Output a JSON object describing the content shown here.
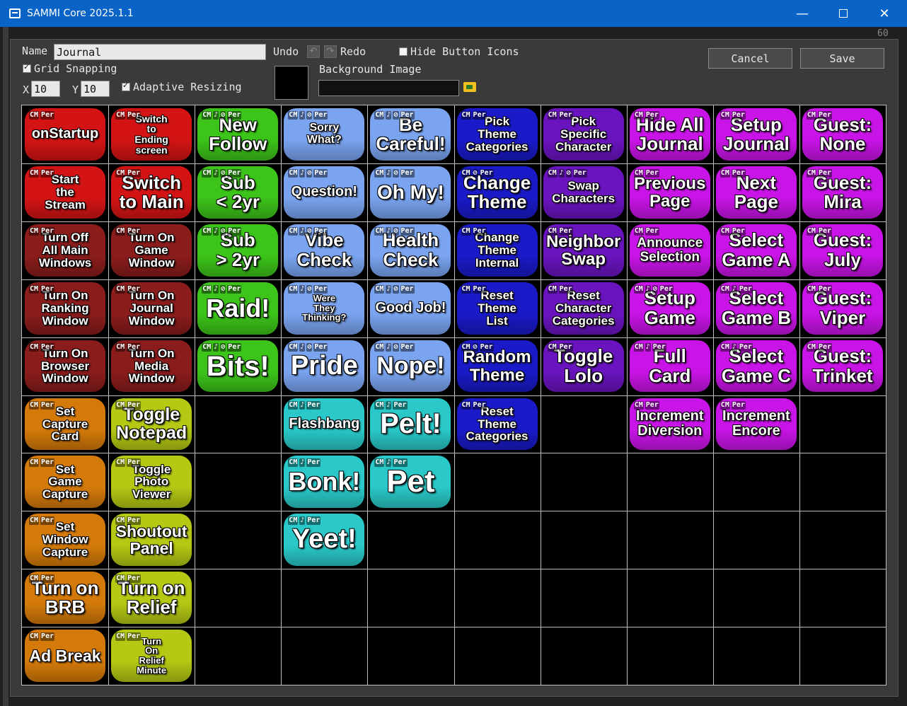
{
  "window": {
    "title": "SAMMI Core 2025.1.1",
    "min_glyph": "—",
    "close_glyph": "✕"
  },
  "background": {
    "corner_number": "60"
  },
  "form": {
    "name_label": "Name",
    "name_value": "Journal",
    "undo_label": "Undo",
    "undo_glyph": "↶",
    "redo_glyph": "↷",
    "redo_label": "Redo",
    "hide_icons_label": "Hide Button Icons",
    "hide_icons_checked": false,
    "grid_snapping_label": "Grid Snapping",
    "grid_snapping_checked": true,
    "x_label": "X",
    "x_value": "10",
    "y_label": "Y",
    "y_value": "10",
    "adaptive_label": "Adaptive Resizing",
    "adaptive_checked": true,
    "bg_image_label": "Background Image",
    "bg_image_value": "",
    "bg_color": "#000000",
    "cancel_label": "Cancel",
    "save_label": "Save"
  },
  "grid": {
    "columns": 10,
    "rows": 10,
    "buttons": [
      {
        "c": 0,
        "r": 0,
        "text": "onStartup",
        "color": "#d41414",
        "size": 20,
        "icons": [
          "CM",
          "Per"
        ]
      },
      {
        "c": 1,
        "r": 0,
        "text": "Switch\nto\nEnding\nscreen",
        "color": "#d41414",
        "size": 14,
        "icons": [
          "CM",
          "Per"
        ]
      },
      {
        "c": 2,
        "r": 0,
        "text": "New\nFollow",
        "color": "#3cc41a",
        "size": 26,
        "icons": [
          "CM",
          "♪",
          "⊘",
          "Per"
        ]
      },
      {
        "c": 3,
        "r": 0,
        "text": "Sorry\nWhat?",
        "color": "#7aa4f0",
        "size": 16,
        "icons": [
          "CM",
          "♪",
          "⊘",
          "Per"
        ]
      },
      {
        "c": 4,
        "r": 0,
        "text": "Be\nCareful!",
        "color": "#7aa4f0",
        "size": 26,
        "icons": [
          "CM",
          "♪",
          "⊘",
          "Per"
        ]
      },
      {
        "c": 5,
        "r": 0,
        "text": "Pick\nTheme\nCategories",
        "color": "#1a1ac8",
        "size": 17,
        "icons": [
          "CM",
          "Per"
        ]
      },
      {
        "c": 6,
        "r": 0,
        "text": "Pick\nSpecific\nCharacter",
        "color": "#6a14c0",
        "size": 17,
        "icons": [
          "CM",
          "Per"
        ]
      },
      {
        "c": 7,
        "r": 0,
        "text": "Hide All\nJournal",
        "color": "#c814e6",
        "size": 26,
        "icons": [
          "CM",
          "Per"
        ]
      },
      {
        "c": 8,
        "r": 0,
        "text": "Setup\nJournal",
        "color": "#c814e6",
        "size": 26,
        "icons": [
          "CM",
          "Per"
        ]
      },
      {
        "c": 9,
        "r": 0,
        "text": "Guest:\nNone",
        "color": "#c814e6",
        "size": 26,
        "icons": [
          "CM",
          "Per"
        ]
      },
      {
        "c": 0,
        "r": 1,
        "text": "Start\nthe\nStream",
        "color": "#d41414",
        "size": 17,
        "icons": [
          "CM",
          "Per"
        ]
      },
      {
        "c": 1,
        "r": 1,
        "text": "Switch\nto Main",
        "color": "#d41414",
        "size": 26,
        "icons": [
          "CM",
          "Per"
        ]
      },
      {
        "c": 2,
        "r": 1,
        "text": "Sub\n< 2yr",
        "color": "#3cc41a",
        "size": 26,
        "icons": [
          "CM",
          "♪",
          "⊘",
          "Per"
        ]
      },
      {
        "c": 3,
        "r": 1,
        "text": "Question!",
        "color": "#7aa4f0",
        "size": 20,
        "icons": [
          "CM",
          "♪",
          "⊘",
          "Per"
        ]
      },
      {
        "c": 4,
        "r": 1,
        "text": "Oh My!",
        "color": "#7aa4f0",
        "size": 28,
        "icons": [
          "CM",
          "♪",
          "⊘",
          "Per"
        ]
      },
      {
        "c": 5,
        "r": 1,
        "text": "Change\nTheme",
        "color": "#1a1ac8",
        "size": 26,
        "icons": [
          "CM",
          "⊘",
          "Per"
        ]
      },
      {
        "c": 6,
        "r": 1,
        "text": "Swap\nCharacters",
        "color": "#6a14c0",
        "size": 17,
        "icons": [
          "CM",
          "♪",
          "⊘",
          "Per"
        ]
      },
      {
        "c": 7,
        "r": 1,
        "text": "Previous\nPage",
        "color": "#c814e6",
        "size": 24,
        "icons": [
          "CM",
          "Per"
        ]
      },
      {
        "c": 8,
        "r": 1,
        "text": "Next\nPage",
        "color": "#c814e6",
        "size": 26,
        "icons": [
          "CM",
          "Per"
        ]
      },
      {
        "c": 9,
        "r": 1,
        "text": "Guest:\nMira",
        "color": "#c814e6",
        "size": 26,
        "icons": [
          "CM",
          "Per"
        ]
      },
      {
        "c": 0,
        "r": 2,
        "text": "Turn Off\nAll Main\nWindows",
        "color": "#8a1c1c",
        "size": 17,
        "icons": [
          "CM",
          "Per"
        ]
      },
      {
        "c": 1,
        "r": 2,
        "text": "Turn On\nGame\nWindow",
        "color": "#8a1c1c",
        "size": 17,
        "icons": [
          "CM",
          "Per"
        ]
      },
      {
        "c": 2,
        "r": 2,
        "text": "Sub\n> 2yr",
        "color": "#3cc41a",
        "size": 26,
        "icons": [
          "CM",
          "♪",
          "⊘",
          "Per"
        ]
      },
      {
        "c": 3,
        "r": 2,
        "text": "Vibe\nCheck",
        "color": "#7aa4f0",
        "size": 26,
        "icons": [
          "CM",
          "♪",
          "⊘",
          "Per"
        ]
      },
      {
        "c": 4,
        "r": 2,
        "text": "Health\nCheck",
        "color": "#7aa4f0",
        "size": 26,
        "icons": [
          "CM",
          "♪",
          "⊘",
          "Per"
        ]
      },
      {
        "c": 5,
        "r": 2,
        "text": "Change\nTheme\nInternal",
        "color": "#1a1ac8",
        "size": 17,
        "icons": [
          "CM",
          "Per"
        ]
      },
      {
        "c": 6,
        "r": 2,
        "text": "Neighbor\nSwap",
        "color": "#6a14c0",
        "size": 24,
        "icons": [
          "CM",
          "Per"
        ]
      },
      {
        "c": 7,
        "r": 2,
        "text": "Announce\nSelection",
        "color": "#c814e6",
        "size": 19,
        "icons": [
          "CM",
          "Per"
        ]
      },
      {
        "c": 8,
        "r": 2,
        "text": "Select\nGame A",
        "color": "#c814e6",
        "size": 26,
        "icons": [
          "CM",
          "Per"
        ]
      },
      {
        "c": 9,
        "r": 2,
        "text": "Guest:\nJuly",
        "color": "#c814e6",
        "size": 26,
        "icons": [
          "CM",
          "Per"
        ]
      },
      {
        "c": 0,
        "r": 3,
        "text": "Turn On\nRanking\nWindow",
        "color": "#8a1c1c",
        "size": 17,
        "icons": [
          "CM",
          "Per"
        ]
      },
      {
        "c": 1,
        "r": 3,
        "text": "Turn On\nJournal\nWindow",
        "color": "#8a1c1c",
        "size": 17,
        "icons": [
          "CM",
          "Per"
        ]
      },
      {
        "c": 2,
        "r": 3,
        "text": "Raid!",
        "color": "#3cc41a",
        "size": 36,
        "icons": [
          "CM",
          "♪",
          "⊘",
          "Per"
        ]
      },
      {
        "c": 3,
        "r": 3,
        "text": "Were\nThey\nThinking?",
        "color": "#7aa4f0",
        "size": 13,
        "icons": [
          "CM",
          "♪",
          "⊘",
          "Per"
        ]
      },
      {
        "c": 4,
        "r": 3,
        "text": "Good Job!",
        "color": "#7aa4f0",
        "size": 20,
        "icons": [
          "CM",
          "♪",
          "⊘",
          "Per"
        ]
      },
      {
        "c": 5,
        "r": 3,
        "text": "Reset\nTheme\nList",
        "color": "#1a1ac8",
        "size": 17,
        "icons": [
          "CM",
          "Per"
        ]
      },
      {
        "c": 6,
        "r": 3,
        "text": "Reset\nCharacter\nCategories",
        "color": "#6a14c0",
        "size": 17,
        "icons": [
          "CM",
          "Per"
        ]
      },
      {
        "c": 7,
        "r": 3,
        "text": "Setup\nGame",
        "color": "#c814e6",
        "size": 26,
        "icons": [
          "CM",
          "♪",
          "⊘",
          "Per"
        ]
      },
      {
        "c": 8,
        "r": 3,
        "text": "Select\nGame B",
        "color": "#c814e6",
        "size": 26,
        "icons": [
          "CM",
          "♪",
          "Per"
        ]
      },
      {
        "c": 9,
        "r": 3,
        "text": "Guest:\nViper",
        "color": "#c814e6",
        "size": 26,
        "icons": [
          "CM",
          "Per"
        ]
      },
      {
        "c": 0,
        "r": 4,
        "text": "Turn On\nBrowser\nWindow",
        "color": "#8a1c1c",
        "size": 17,
        "icons": [
          "CM",
          "Per"
        ]
      },
      {
        "c": 1,
        "r": 4,
        "text": "Turn On\nMedia\nWindow",
        "color": "#8a1c1c",
        "size": 17,
        "icons": [
          "CM",
          "Per"
        ]
      },
      {
        "c": 2,
        "r": 4,
        "text": "Bits!",
        "color": "#3cc41a",
        "size": 40,
        "icons": [
          "CM",
          "♪",
          "⊘",
          "Per"
        ]
      },
      {
        "c": 3,
        "r": 4,
        "text": "Pride",
        "color": "#7aa4f0",
        "size": 38,
        "icons": [
          "CM",
          "♪",
          "⊘",
          "Per"
        ]
      },
      {
        "c": 4,
        "r": 4,
        "text": "Nope!",
        "color": "#7aa4f0",
        "size": 34,
        "icons": [
          "CM",
          "♪",
          "⊘",
          "Per"
        ]
      },
      {
        "c": 5,
        "r": 4,
        "text": "Random\nTheme",
        "color": "#1a1ac8",
        "size": 24,
        "icons": [
          "CM",
          "⊘",
          "Per"
        ]
      },
      {
        "c": 6,
        "r": 4,
        "text": "Toggle\nLolo",
        "color": "#6a14c0",
        "size": 26,
        "icons": [
          "CM",
          "Per"
        ]
      },
      {
        "c": 7,
        "r": 4,
        "text": "Full\nCard",
        "color": "#c814e6",
        "size": 26,
        "icons": [
          "CM",
          "♪",
          "Per"
        ]
      },
      {
        "c": 8,
        "r": 4,
        "text": "Select\nGame C",
        "color": "#c814e6",
        "size": 26,
        "icons": [
          "CM",
          "♪",
          "Per"
        ]
      },
      {
        "c": 9,
        "r": 4,
        "text": "Guest:\nTrinket",
        "color": "#c814e6",
        "size": 26,
        "icons": [
          "CM",
          "Per"
        ]
      },
      {
        "c": 0,
        "r": 5,
        "text": "Set\nCapture\nCard",
        "color": "#d47a0a",
        "size": 17,
        "icons": [
          "CM",
          "Per"
        ]
      },
      {
        "c": 1,
        "r": 5,
        "text": "Toggle\nNotepad",
        "color": "#b4c814",
        "size": 25,
        "icons": [
          "CM",
          "Per"
        ]
      },
      {
        "c": 3,
        "r": 5,
        "text": "Flashbang",
        "color": "#2ac8c8",
        "size": 20,
        "icons": [
          "CM",
          "♪",
          "Per"
        ]
      },
      {
        "c": 4,
        "r": 5,
        "text": "Pelt!",
        "color": "#2ac8c8",
        "size": 40,
        "icons": [
          "CM",
          "♪",
          "Per"
        ]
      },
      {
        "c": 5,
        "r": 5,
        "text": "Reset\nTheme\nCategories",
        "color": "#1a1ac8",
        "size": 17,
        "icons": [
          "CM",
          "Per"
        ]
      },
      {
        "c": 7,
        "r": 5,
        "text": "Increment\nDiversion",
        "color": "#c814e6",
        "size": 20,
        "icons": [
          "CM",
          "Per"
        ]
      },
      {
        "c": 8,
        "r": 5,
        "text": "Increment\nEncore",
        "color": "#c814e6",
        "size": 20,
        "icons": [
          "CM",
          "Per"
        ]
      },
      {
        "c": 0,
        "r": 6,
        "text": "Set\nGame\nCapture",
        "color": "#d47a0a",
        "size": 17,
        "icons": [
          "CM",
          "Per"
        ]
      },
      {
        "c": 1,
        "r": 6,
        "text": "Toggle\nPhoto\nViewer",
        "color": "#b4c814",
        "size": 17,
        "icons": [
          "CM",
          "Per"
        ]
      },
      {
        "c": 3,
        "r": 6,
        "text": "Bonk!",
        "color": "#2ac8c8",
        "size": 36,
        "icons": [
          "CM",
          "♪",
          "Per"
        ]
      },
      {
        "c": 4,
        "r": 6,
        "text": "Pet",
        "color": "#2ac8c8",
        "size": 44,
        "icons": [
          "CM",
          "♪",
          "Per"
        ]
      },
      {
        "c": 0,
        "r": 7,
        "text": "Set\nWindow\nCapture",
        "color": "#d47a0a",
        "size": 17,
        "icons": [
          "CM",
          "Per"
        ]
      },
      {
        "c": 1,
        "r": 7,
        "text": "Shoutout\nPanel",
        "color": "#b4c814",
        "size": 23,
        "icons": [
          "CM",
          "Per"
        ]
      },
      {
        "c": 3,
        "r": 7,
        "text": "Yeet!",
        "color": "#2ac8c8",
        "size": 38,
        "icons": [
          "CM",
          "♪",
          "Per"
        ]
      },
      {
        "c": 0,
        "r": 8,
        "text": "Turn on\nBRB",
        "color": "#d47a0a",
        "size": 26,
        "icons": [
          "CM",
          "Per"
        ]
      },
      {
        "c": 1,
        "r": 8,
        "text": "Turn on\nRelief",
        "color": "#b4c814",
        "size": 26,
        "icons": [
          "CM",
          "Per"
        ]
      },
      {
        "c": 0,
        "r": 9,
        "text": "Ad Break",
        "color": "#d47a0a",
        "size": 23,
        "icons": [
          "CM",
          "Per"
        ]
      },
      {
        "c": 1,
        "r": 9,
        "text": "Turn\nOn\nRelief\nMinute",
        "color": "#b4c814",
        "size": 13,
        "icons": [
          "CM",
          "Per"
        ]
      }
    ]
  }
}
